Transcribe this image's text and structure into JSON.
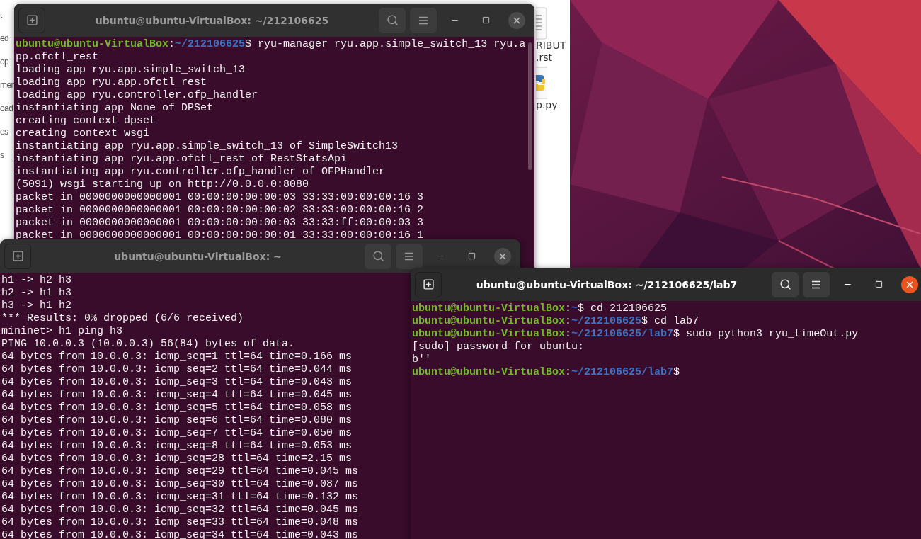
{
  "desktop": {
    "file_manager": {
      "sidebar_fragments": [
        "t",
        "ed",
        "op",
        "men",
        "oad",
        "es",
        "s"
      ],
      "files": [
        {
          "kind": "document",
          "name_lines": [
            "RIBUT",
            ".rst"
          ]
        },
        {
          "kind": "python",
          "name_lines": [
            "p.py"
          ]
        }
      ]
    }
  },
  "windows": [
    {
      "title": "ubuntu@ubuntu-VirtualBox: ~/212106625",
      "active": false,
      "lines": [
        {
          "segments": [
            {
              "kind": "user",
              "text": "ubuntu@ubuntu-VirtualBox"
            },
            {
              "kind": "plain",
              "text": ":"
            },
            {
              "kind": "path",
              "text": "~/212106625"
            },
            {
              "kind": "plain",
              "text": "$ ryu-manager ryu.app.simple_switch_13 ryu.a"
            }
          ]
        },
        {
          "segments": [
            {
              "kind": "plain",
              "text": "pp.ofctl_rest"
            }
          ]
        },
        {
          "segments": [
            {
              "kind": "plain",
              "text": "loading app ryu.app.simple_switch_13"
            }
          ]
        },
        {
          "segments": [
            {
              "kind": "plain",
              "text": "loading app ryu.app.ofctl_rest"
            }
          ]
        },
        {
          "segments": [
            {
              "kind": "plain",
              "text": "loading app ryu.controller.ofp_handler"
            }
          ]
        },
        {
          "segments": [
            {
              "kind": "plain",
              "text": "instantiating app None of DPSet"
            }
          ]
        },
        {
          "segments": [
            {
              "kind": "plain",
              "text": "creating context dpset"
            }
          ]
        },
        {
          "segments": [
            {
              "kind": "plain",
              "text": "creating context wsgi"
            }
          ]
        },
        {
          "segments": [
            {
              "kind": "plain",
              "text": "instantiating app ryu.app.simple_switch_13 of SimpleSwitch13"
            }
          ]
        },
        {
          "segments": [
            {
              "kind": "plain",
              "text": "instantiating app ryu.app.ofctl_rest of RestStatsApi"
            }
          ]
        },
        {
          "segments": [
            {
              "kind": "plain",
              "text": "instantiating app ryu.controller.ofp_handler of OFPHandler"
            }
          ]
        },
        {
          "segments": [
            {
              "kind": "plain",
              "text": "(5091) wsgi starting up on http://0.0.0.0:8080"
            }
          ]
        },
        {
          "segments": [
            {
              "kind": "plain",
              "text": "packet in 0000000000000001 00:00:00:00:00:03 33:33:00:00:00:16 3"
            }
          ]
        },
        {
          "segments": [
            {
              "kind": "plain",
              "text": "packet in 0000000000000001 00:00:00:00:00:02 33:33:00:00:00:16 2"
            }
          ]
        },
        {
          "segments": [
            {
              "kind": "plain",
              "text": "packet in 0000000000000001 00:00:00:00:00:03 33:33:ff:00:00:03 3"
            }
          ]
        },
        {
          "segments": [
            {
              "kind": "plain",
              "text": "packet in 0000000000000001 00:00:00:00:00:01 33:33:00:00:00:16 1"
            }
          ]
        }
      ]
    },
    {
      "title": "ubuntu@ubuntu-VirtualBox: ~",
      "active": false,
      "lines": [
        {
          "segments": [
            {
              "kind": "plain",
              "text": "h1 -> h2 h3"
            }
          ]
        },
        {
          "segments": [
            {
              "kind": "plain",
              "text": "h2 -> h1 h3"
            }
          ]
        },
        {
          "segments": [
            {
              "kind": "plain",
              "text": "h3 -> h1 h2"
            }
          ]
        },
        {
          "segments": [
            {
              "kind": "plain",
              "text": "*** Results: 0% dropped (6/6 received)"
            }
          ]
        },
        {
          "segments": [
            {
              "kind": "plain",
              "text": "mininet> h1 ping h3"
            }
          ]
        },
        {
          "segments": [
            {
              "kind": "plain",
              "text": "PING 10.0.0.3 (10.0.0.3) 56(84) bytes of data."
            }
          ]
        },
        {
          "segments": [
            {
              "kind": "plain",
              "text": "64 bytes from 10.0.0.3: icmp_seq=1 ttl=64 time=0.166 ms"
            }
          ]
        },
        {
          "segments": [
            {
              "kind": "plain",
              "text": "64 bytes from 10.0.0.3: icmp_seq=2 ttl=64 time=0.044 ms"
            }
          ]
        },
        {
          "segments": [
            {
              "kind": "plain",
              "text": "64 bytes from 10.0.0.3: icmp_seq=3 ttl=64 time=0.043 ms"
            }
          ]
        },
        {
          "segments": [
            {
              "kind": "plain",
              "text": "64 bytes from 10.0.0.3: icmp_seq=4 ttl=64 time=0.045 ms"
            }
          ]
        },
        {
          "segments": [
            {
              "kind": "plain",
              "text": "64 bytes from 10.0.0.3: icmp_seq=5 ttl=64 time=0.058 ms"
            }
          ]
        },
        {
          "segments": [
            {
              "kind": "plain",
              "text": "64 bytes from 10.0.0.3: icmp_seq=6 ttl=64 time=0.080 ms"
            }
          ]
        },
        {
          "segments": [
            {
              "kind": "plain",
              "text": "64 bytes from 10.0.0.3: icmp_seq=7 ttl=64 time=0.050 ms"
            }
          ]
        },
        {
          "segments": [
            {
              "kind": "plain",
              "text": "64 bytes from 10.0.0.3: icmp_seq=8 ttl=64 time=0.053 ms"
            }
          ]
        },
        {
          "segments": [
            {
              "kind": "plain",
              "text": "64 bytes from 10.0.0.3: icmp_seq=28 ttl=64 time=2.15 ms"
            }
          ]
        },
        {
          "segments": [
            {
              "kind": "plain",
              "text": "64 bytes from 10.0.0.3: icmp_seq=29 ttl=64 time=0.045 ms"
            }
          ]
        },
        {
          "segments": [
            {
              "kind": "plain",
              "text": "64 bytes from 10.0.0.3: icmp_seq=30 ttl=64 time=0.087 ms"
            }
          ]
        },
        {
          "segments": [
            {
              "kind": "plain",
              "text": "64 bytes from 10.0.0.3: icmp_seq=31 ttl=64 time=0.132 ms"
            }
          ]
        },
        {
          "segments": [
            {
              "kind": "plain",
              "text": "64 bytes from 10.0.0.3: icmp_seq=32 ttl=64 time=0.045 ms"
            }
          ]
        },
        {
          "segments": [
            {
              "kind": "plain",
              "text": "64 bytes from 10.0.0.3: icmp_seq=33 ttl=64 time=0.048 ms"
            }
          ]
        },
        {
          "segments": [
            {
              "kind": "plain",
              "text": "64 bytes from 10.0.0.3: icmp_seq=34 ttl=64 time=0.043 ms"
            }
          ]
        }
      ]
    },
    {
      "title": "ubuntu@ubuntu-VirtualBox: ~/212106625/lab7",
      "active": true,
      "lines": [
        {
          "segments": [
            {
              "kind": "user",
              "text": "ubuntu@ubuntu-VirtualBox"
            },
            {
              "kind": "plain",
              "text": ":"
            },
            {
              "kind": "path",
              "text": "~"
            },
            {
              "kind": "plain",
              "text": "$ cd 212106625"
            }
          ]
        },
        {
          "segments": [
            {
              "kind": "user",
              "text": "ubuntu@ubuntu-VirtualBox"
            },
            {
              "kind": "plain",
              "text": ":"
            },
            {
              "kind": "path",
              "text": "~/212106625"
            },
            {
              "kind": "plain",
              "text": "$ cd lab7"
            }
          ]
        },
        {
          "segments": [
            {
              "kind": "user",
              "text": "ubuntu@ubuntu-VirtualBox"
            },
            {
              "kind": "plain",
              "text": ":"
            },
            {
              "kind": "path",
              "text": "~/212106625/lab7"
            },
            {
              "kind": "plain",
              "text": "$ sudo python3 ryu_timeOut.py"
            }
          ]
        },
        {
          "segments": [
            {
              "kind": "plain",
              "text": "[sudo] password for ubuntu:"
            }
          ]
        },
        {
          "segments": [
            {
              "kind": "plain",
              "text": "b''"
            }
          ]
        },
        {
          "segments": [
            {
              "kind": "user",
              "text": "ubuntu@ubuntu-VirtualBox"
            },
            {
              "kind": "plain",
              "text": ":"
            },
            {
              "kind": "path",
              "text": "~/212106625/lab7"
            },
            {
              "kind": "plain",
              "text": "$"
            }
          ]
        }
      ]
    }
  ]
}
